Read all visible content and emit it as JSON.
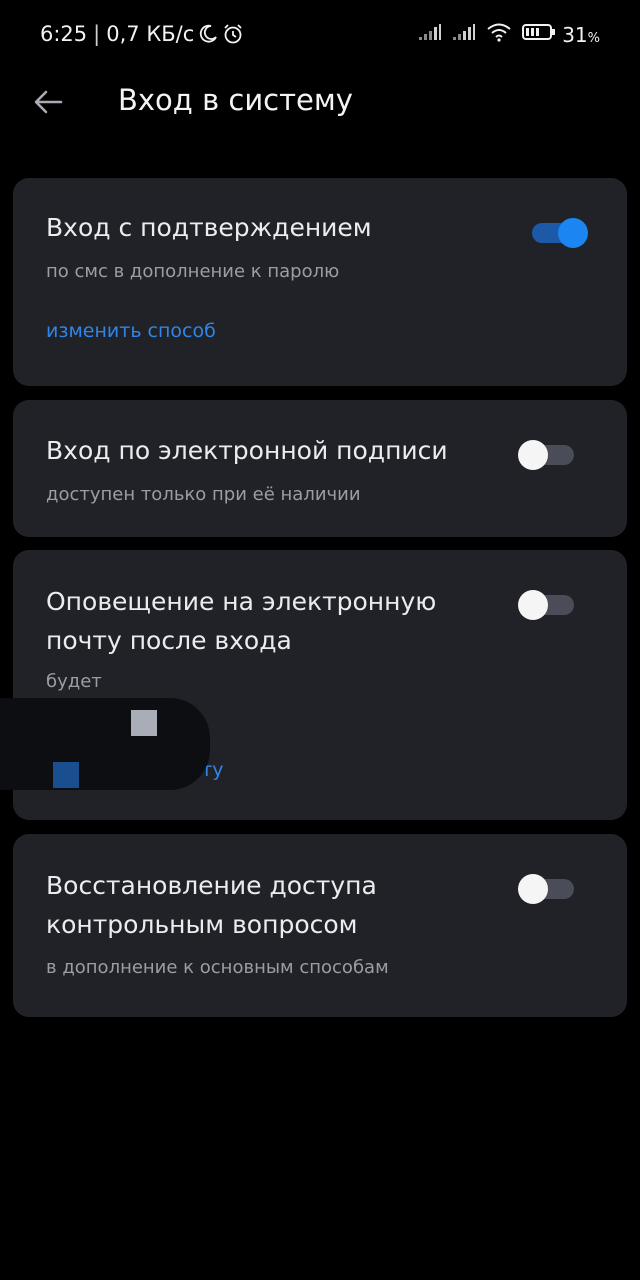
{
  "status_bar": {
    "time": "6:25",
    "separator": "|",
    "network_speed": "0,7 КБ/с",
    "battery": "31",
    "battery_unit": "%"
  },
  "header": {
    "title": "Вход в систему"
  },
  "settings": [
    {
      "title": "Вход с подтверждением",
      "subtitle": "по смс в дополнение к паролю",
      "link": "изменить способ",
      "enabled": true
    },
    {
      "title": "Вход по электронной подписи",
      "subtitle": "доступен только при её наличии",
      "enabled": false
    },
    {
      "title": "Оповещение на электронную почту после входа",
      "subtitle": "будет",
      "link": "ть эл.почту",
      "enabled": false
    },
    {
      "title": "Восстановление доступа контрольным вопросом",
      "subtitle": "в дополнение к основным способам",
      "enabled": false
    }
  ],
  "colors": {
    "background": "#000000",
    "card": "#212227",
    "accent": "#1b85f2",
    "link": "#2f86e6"
  }
}
